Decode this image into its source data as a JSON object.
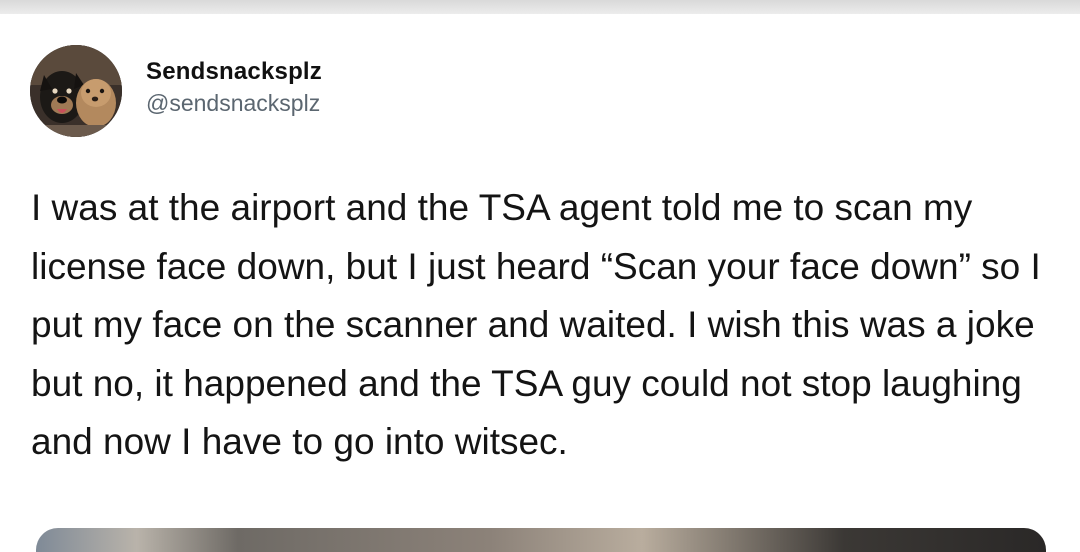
{
  "tweet": {
    "author": {
      "display_name": "Sendsnacksplz",
      "handle": "@sendsnacksplz",
      "avatar_icon": "dogs-avatar-photo"
    },
    "text": "I was at the airport and the TSA agent told me to scan my license face down, but I just heard “Scan your face down” so I put my face on the scanner and waited. I wish this was a joke but no, it happened and the TSA guy could not stop laughing and now I have to go into witsec."
  },
  "colors": {
    "text": "#141414",
    "handle": "#5b6670",
    "background": "#ffffff"
  }
}
